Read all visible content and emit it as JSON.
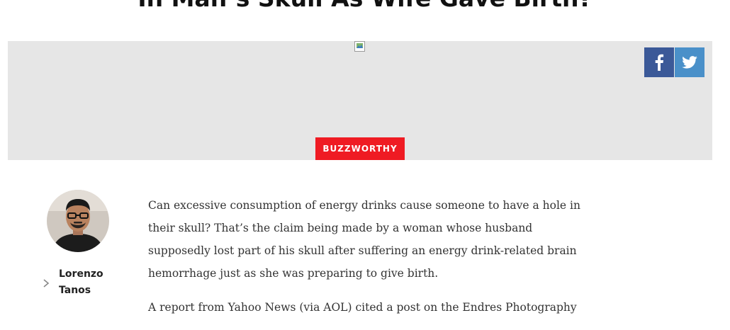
{
  "article": {
    "headline": "In Man’s Skull As Wife Gave Birth?",
    "category": "BUZZWORTHY",
    "paragraphs": [
      "Can excessive consumption of energy drinks cause someone to have a hole in their skull? That’s the claim being made by a woman whose husband supposedly lost part of his skull after suffering an energy drink-related brain hemorrhage just as she was preparing to give birth.",
      "A report from Yahoo News (via AOL) cited a post on the Endres Photography"
    ]
  },
  "share": {
    "facebook_icon": "facebook-icon",
    "twitter_icon": "twitter-icon",
    "colors": {
      "facebook": "#3b5998",
      "twitter": "#4a90c9"
    }
  },
  "author": {
    "name_line1": "Lorenzo",
    "name_line2": "Tanos"
  },
  "colors": {
    "badge": "#ef1b23",
    "hero_bg": "#e6e6e6"
  }
}
